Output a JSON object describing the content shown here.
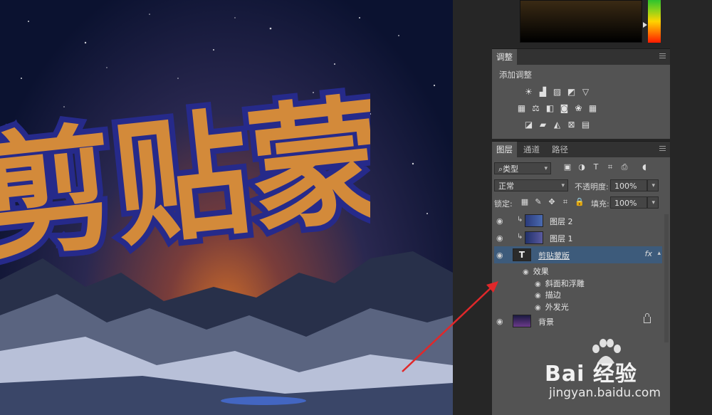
{
  "canvas": {
    "headline": "剪贴蒙版"
  },
  "adjustments_panel": {
    "tab_label": "调整",
    "add_label": "添加调整",
    "icons_row1": [
      "brightness-icon",
      "levels-icon",
      "curves-icon",
      "exposure-icon",
      "vibrance-icon"
    ],
    "icons_row2": [
      "hue-saturation-icon",
      "color-balance-icon",
      "black-white-icon",
      "photo-filter-icon",
      "channel-mixer-icon",
      "color-lookup-icon"
    ],
    "icons_row3": [
      "invert-icon",
      "posterize-icon",
      "threshold-icon",
      "selective-color-icon",
      "gradient-map-icon"
    ]
  },
  "layers_panel": {
    "tabs": [
      "图层",
      "通道",
      "路径"
    ],
    "filter_kind": "类型",
    "blend_mode": "正常",
    "opacity_label": "不透明度:",
    "opacity_value": "100%",
    "lock_label": "锁定:",
    "fill_label": "填充:",
    "fill_value": "100%",
    "layers": [
      {
        "name": "图层 2",
        "clipped": true
      },
      {
        "name": "图层 1",
        "clipped": true
      },
      {
        "name": "剪贴蒙版",
        "type": "text",
        "fx": "fx",
        "selected": true
      }
    ],
    "effects_label": "效果",
    "effects": [
      "斜面和浮雕",
      "描边",
      "外发光"
    ],
    "background_layer": "背景"
  },
  "watermark": {
    "brand": "Bai 经验",
    "url": "jingyan.baidu.com"
  },
  "colors": {
    "selection": "#3d5b7b",
    "arrow": "#e0282a",
    "text_fill": "#d38a3a",
    "text_outline": "#262a8a"
  }
}
